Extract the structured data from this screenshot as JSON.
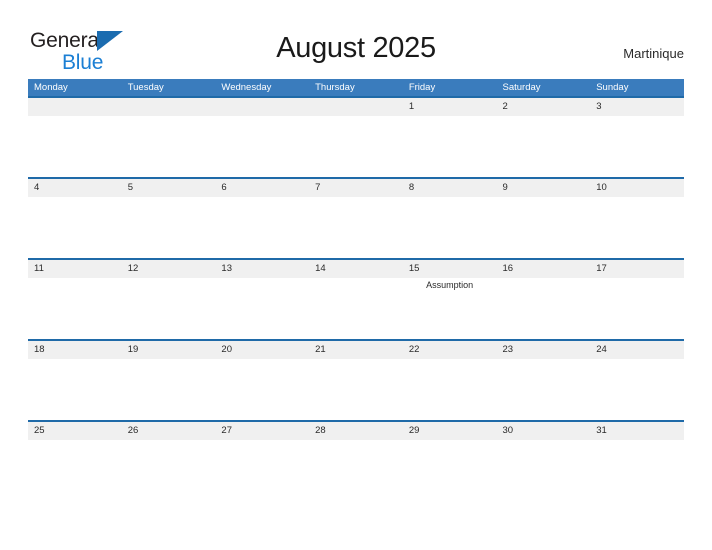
{
  "brand": {
    "name_part1": "General",
    "name_part2": "Blue",
    "triangle_icon": "triangle-icon",
    "colors": {
      "dark_text": "#231f20",
      "blue_text": "#1b7fd4",
      "triangle": "#1b6cb0"
    }
  },
  "header": {
    "title": "August 2025",
    "region": "Martinique"
  },
  "theme": {
    "header_blue": "#3a7cbd",
    "divider_blue": "#1f6aa8",
    "date_band_gray": "#f0f0f0",
    "page_background": "#ffffff"
  },
  "calendar": {
    "month": "August",
    "year": "2025",
    "weekday_headers": [
      {
        "label": "Monday"
      },
      {
        "label": "Tuesday"
      },
      {
        "label": "Wednesday"
      },
      {
        "label": "Thursday"
      },
      {
        "label": "Friday"
      },
      {
        "label": "Saturday"
      },
      {
        "label": "Sunday"
      }
    ],
    "weeks": [
      {
        "days": [
          {
            "date": "",
            "event": ""
          },
          {
            "date": "",
            "event": ""
          },
          {
            "date": "",
            "event": ""
          },
          {
            "date": "",
            "event": ""
          },
          {
            "date": "1",
            "event": ""
          },
          {
            "date": "2",
            "event": ""
          },
          {
            "date": "3",
            "event": ""
          }
        ]
      },
      {
        "days": [
          {
            "date": "4",
            "event": ""
          },
          {
            "date": "5",
            "event": ""
          },
          {
            "date": "6",
            "event": ""
          },
          {
            "date": "7",
            "event": ""
          },
          {
            "date": "8",
            "event": ""
          },
          {
            "date": "9",
            "event": ""
          },
          {
            "date": "10",
            "event": ""
          }
        ]
      },
      {
        "days": [
          {
            "date": "11",
            "event": ""
          },
          {
            "date": "12",
            "event": ""
          },
          {
            "date": "13",
            "event": ""
          },
          {
            "date": "14",
            "event": ""
          },
          {
            "date": "15",
            "event": "Assumption"
          },
          {
            "date": "16",
            "event": ""
          },
          {
            "date": "17",
            "event": ""
          }
        ]
      },
      {
        "days": [
          {
            "date": "18",
            "event": ""
          },
          {
            "date": "19",
            "event": ""
          },
          {
            "date": "20",
            "event": ""
          },
          {
            "date": "21",
            "event": ""
          },
          {
            "date": "22",
            "event": ""
          },
          {
            "date": "23",
            "event": ""
          },
          {
            "date": "24",
            "event": ""
          }
        ]
      },
      {
        "days": [
          {
            "date": "25",
            "event": ""
          },
          {
            "date": "26",
            "event": ""
          },
          {
            "date": "27",
            "event": ""
          },
          {
            "date": "28",
            "event": ""
          },
          {
            "date": "29",
            "event": ""
          },
          {
            "date": "30",
            "event": ""
          },
          {
            "date": "31",
            "event": ""
          }
        ]
      }
    ]
  }
}
